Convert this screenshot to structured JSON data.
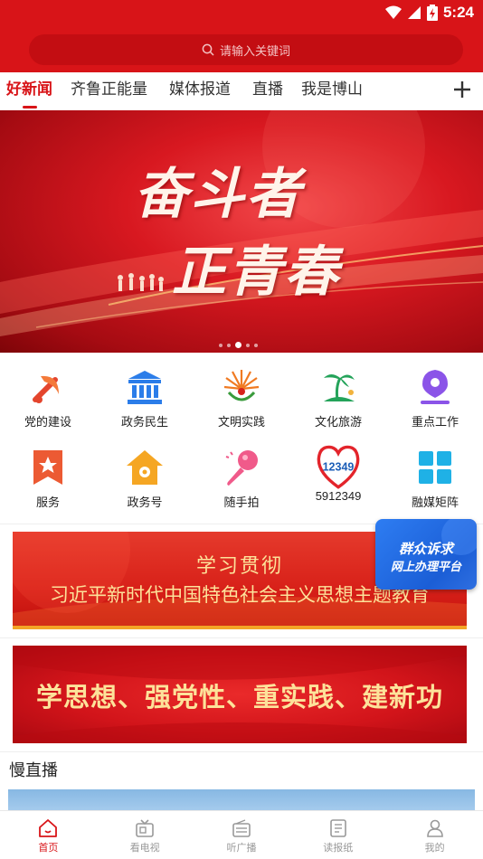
{
  "status_bar": {
    "time": "5:24"
  },
  "search": {
    "placeholder": "请输入关键词"
  },
  "tabs": [
    {
      "label": "好新闻",
      "active": true
    },
    {
      "label": "齐鲁正能量",
      "active": false
    },
    {
      "label": "媒体报道",
      "active": false
    },
    {
      "label": "直播",
      "active": false
    },
    {
      "label": "我是博山",
      "active": false
    }
  ],
  "banner": {
    "line1": "奋斗者",
    "line2": "正青春",
    "slide_count": 5,
    "active_slide": 3
  },
  "grid": [
    {
      "label": "党的建设",
      "icon": "party-flag-icon"
    },
    {
      "label": "政务民生",
      "icon": "government-building-icon"
    },
    {
      "label": "文明实践",
      "icon": "civilization-emblem-icon"
    },
    {
      "label": "文化旅游",
      "icon": "palm-island-icon"
    },
    {
      "label": "重点工作",
      "icon": "location-pen-icon"
    },
    {
      "label": "服务",
      "icon": "bookmark-star-icon"
    },
    {
      "label": "政务号",
      "icon": "house-icon"
    },
    {
      "label": "随手拍",
      "icon": "microphone-icon"
    },
    {
      "label": "5912349",
      "icon": "heart-12349-icon",
      "icon_text": "12349"
    },
    {
      "label": "融媒矩阵",
      "icon": "matrix-grid-icon"
    }
  ],
  "promo1": {
    "line1": "学习贯彻",
    "line2": "习近平新时代中国特色社会主义思想主题教育"
  },
  "promo2": {
    "text": "学思想、强党性、重实践、建新功"
  },
  "float_button": {
    "line1": "群众诉求",
    "line2": "网上办理平台"
  },
  "section": {
    "title": "慢直播"
  },
  "bottom_nav": [
    {
      "label": "首页",
      "icon": "home-icon",
      "active": true
    },
    {
      "label": "看电视",
      "icon": "tv-icon",
      "active": false
    },
    {
      "label": "听广播",
      "icon": "radio-icon",
      "active": false
    },
    {
      "label": "读报纸",
      "icon": "newspaper-icon",
      "active": false
    },
    {
      "label": "我的",
      "icon": "user-icon",
      "active": false
    }
  ],
  "colors": {
    "brand_red": "#d81418",
    "gold_text": "#fde29a",
    "float_blue": "#1b5ed6",
    "nav_inactive": "#999999"
  }
}
